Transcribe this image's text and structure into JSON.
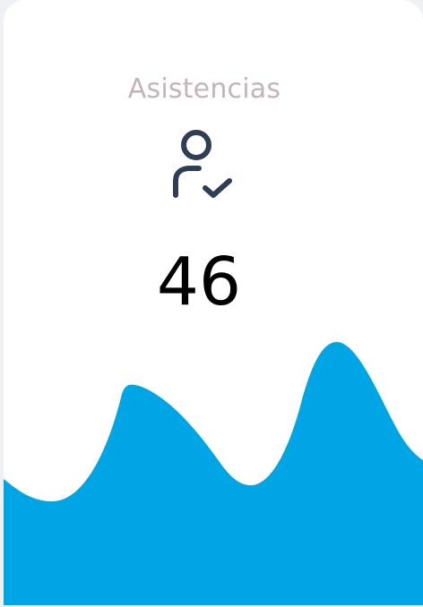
{
  "card": {
    "title": "Asistencias",
    "icon": "user-check-icon",
    "value": "46",
    "colors": {
      "title": "#c3b4b8",
      "icon": "#2f3e55",
      "value": "#000000",
      "wave": "#00a5e6"
    }
  }
}
